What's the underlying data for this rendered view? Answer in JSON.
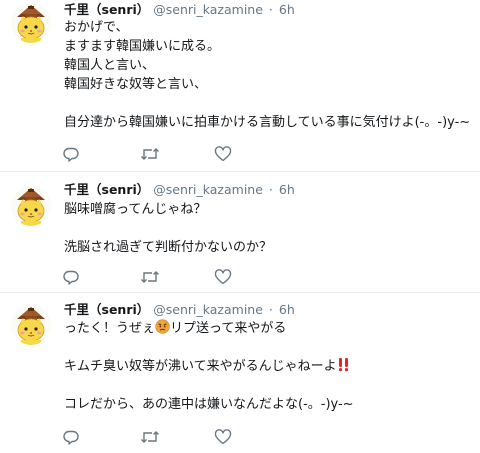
{
  "tweets": [
    {
      "name": "千里（senri）",
      "handle": "@senri_kazamine",
      "dot": "·",
      "time": "6h",
      "lines": [
        "おかげで、",
        "ますます韓国嫌いに成る。",
        "韓国人と言い、",
        "韓国好きな奴等と言い、",
        "",
        "自分達から韓国嫌いに拍車かける言動している事に気付けよ(-。-)y-~"
      ]
    },
    {
      "name": "千里（senri）",
      "handle": "@senri_kazamine",
      "dot": "·",
      "time": "6h",
      "lines": [
        "脳味噌腐ってんじゃね？",
        "",
        "洗脳され過ぎて判断付かないのか？"
      ]
    },
    {
      "name": "千里（senri）",
      "handle": "@senri_kazamine",
      "dot": "·",
      "time": "6h",
      "line1_before": "ったく！うぜぇ",
      "line1_after": "リプ送って来やがる",
      "line2": "",
      "line3": "キムチ臭い奴等が沸いて来やがるんじゃねーよ",
      "line4": "",
      "line5": "コレだから、あの連中は嫌いなんだよな(-。-)y-~"
    }
  ],
  "icons": {
    "avatar": "shimanekko-mascot-avatar",
    "reply": "reply-icon",
    "retweet": "retweet-icon",
    "like": "heart-icon",
    "angry": "angry-face-emoji",
    "exclamation": "double-exclamation-emoji"
  },
  "colors": {
    "text": "#14171a",
    "muted": "#657786",
    "divider": "#e6ecf0",
    "emoji_red": "#e0242a"
  }
}
